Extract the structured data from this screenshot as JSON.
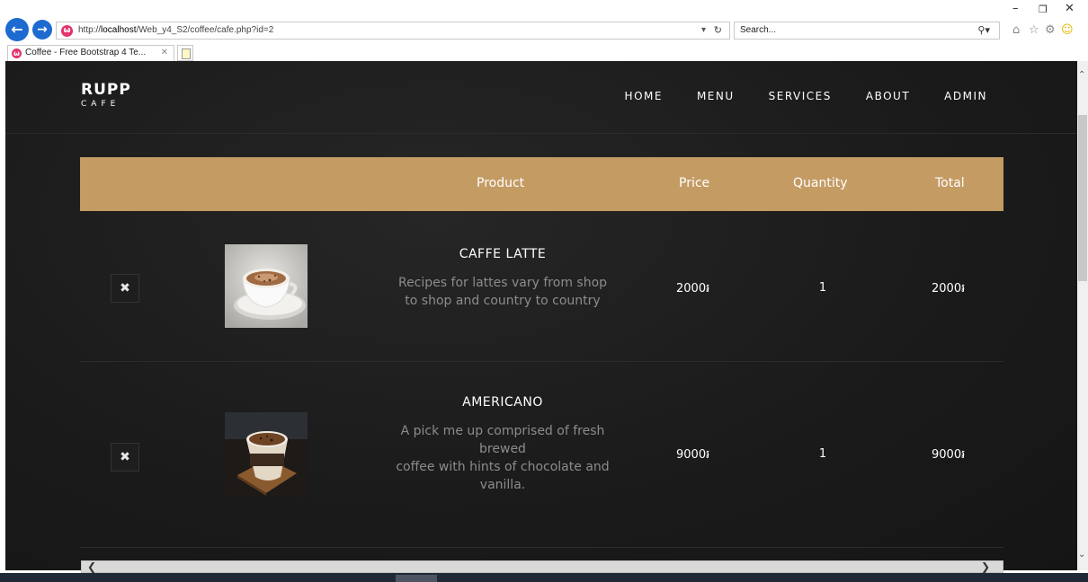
{
  "browser": {
    "url_prefix": "http://",
    "url_host": "localhost",
    "url_path": "/Web_y4_S2/coffee/cafe.php?id=2",
    "search_placeholder": "Search...",
    "tab_title": "Coffee - Free Bootstrap 4 Te..."
  },
  "site": {
    "brand_top": "RUPP",
    "brand_bottom": "CAFE",
    "nav": [
      "HOME",
      "MENU",
      "SERVICES",
      "ABOUT",
      "ADMIN"
    ]
  },
  "cart": {
    "headers": {
      "product": "Product",
      "price": "Price",
      "quantity": "Quantity",
      "total": "Total"
    },
    "items": [
      {
        "name": "CAFFE LATTE",
        "desc_lines": [
          "Recipes for lattes vary from shop",
          "to shop and country to country"
        ],
        "price": "2000៛",
        "quantity": "1",
        "total": "2000៛",
        "image": "latte-cup-photo"
      },
      {
        "name": "AMERICANO",
        "desc_lines": [
          "A pick me up comprised of fresh",
          "brewed",
          "coffee with hints of chocolate and",
          "vanilla."
        ],
        "price": "9000៛",
        "quantity": "1",
        "total": "9000៛",
        "image": "americano-cup-photo"
      }
    ]
  },
  "colors": {
    "header_gold": "#c49b63",
    "page_bg": "#1b1b1b"
  }
}
